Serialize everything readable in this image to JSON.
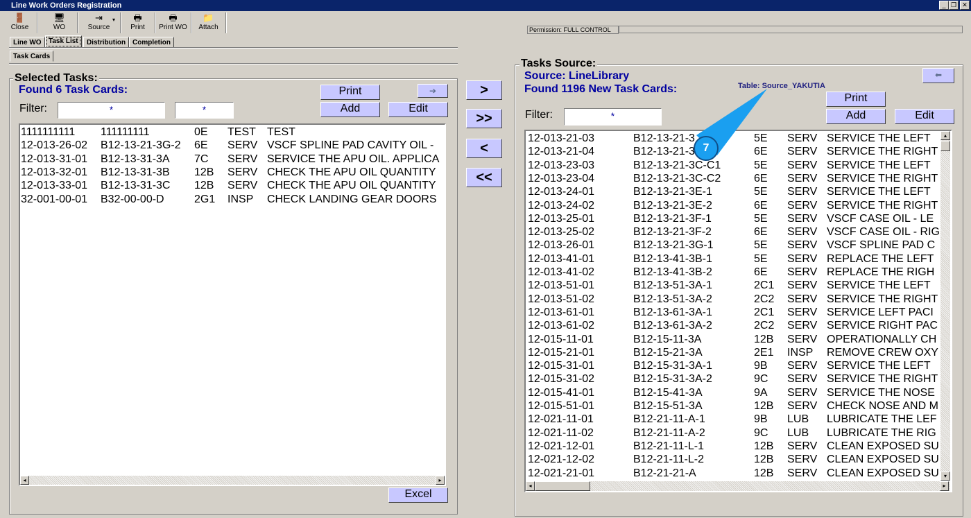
{
  "window": {
    "title": "Line Work Orders Registration"
  },
  "toolbar": [
    {
      "label": "Close",
      "icon": "door-exit-icon"
    },
    {
      "label": "WO",
      "icon": "wo-icon"
    },
    {
      "label": "Source",
      "icon": "source-icon"
    },
    {
      "label": "Print",
      "icon": "printer-icon"
    },
    {
      "label": "Print WO",
      "icon": "printer-icon"
    },
    {
      "label": "Attach",
      "icon": "attach-icon"
    }
  ],
  "permission": {
    "label": "Permission:",
    "value": "FULL CONTROL"
  },
  "tabs": [
    "Line WO",
    "Task List",
    "Distribution",
    "Completion"
  ],
  "subtabs": [
    "Task Cards"
  ],
  "selected": {
    "title": "Selected Tasks:",
    "found": "Found 6 Task Cards:",
    "filter_label": "Filter:",
    "filter1": "*",
    "filter2": "*",
    "print": "Print",
    "add": "Add",
    "edit": "Edit",
    "excel": "Excel",
    "rows": [
      [
        "1111111111",
        "111111111",
        "0E",
        "TEST",
        "TEST"
      ],
      [
        "12-013-26-02",
        "B12-13-21-3G-2",
        "6E",
        "SERV",
        "VSCF SPLINE PAD CAVITY OIL -"
      ],
      [
        "12-013-31-01",
        "B12-13-31-3A",
        "7C",
        "SERV",
        "SERVICE THE APU OIL. APPLICA"
      ],
      [
        "12-013-32-01",
        "B12-13-31-3B",
        "12B",
        "SERV",
        "CHECK THE APU OIL QUANTITY"
      ],
      [
        "12-013-33-01",
        "B12-13-31-3C",
        "12B",
        "SERV",
        "CHECK THE APU OIL QUANTITY"
      ],
      [
        "32-001-00-01",
        "B32-00-00-D",
        "2G1",
        "INSP",
        "CHECK LANDING GEAR DOORS"
      ]
    ]
  },
  "move": {
    "add_one": ">",
    "add_all": ">>",
    "remove_one": "<",
    "remove_all": "<<"
  },
  "source": {
    "title": "Tasks Source:",
    "source": "Source: LineLibrary",
    "found": "Found 1196 New Task Cards:",
    "table": "Table: Source_YAKUTIA",
    "filter_label": "Filter:",
    "filter": "*",
    "print": "Print",
    "add": "Add",
    "edit": "Edit",
    "rows": [
      [
        "12-013-21-03",
        "B12-13-21-3",
        "5E",
        "SERV",
        "SERVICE THE LEFT"
      ],
      [
        "12-013-21-04",
        "B12-13-21-3",
        "6E",
        "SERV",
        "SERVICE THE RIGHT"
      ],
      [
        "12-013-23-03",
        "B12-13-21-3C-C1",
        "5E",
        "SERV",
        "SERVICE THE LEFT"
      ],
      [
        "12-013-23-04",
        "B12-13-21-3C-C2",
        "6E",
        "SERV",
        "SERVICE THE RIGHT"
      ],
      [
        "12-013-24-01",
        "B12-13-21-3E-1",
        "5E",
        "SERV",
        "SERVICE THE LEFT"
      ],
      [
        "12-013-24-02",
        "B12-13-21-3E-2",
        "6E",
        "SERV",
        "SERVICE THE RIGHT"
      ],
      [
        "12-013-25-01",
        "B12-13-21-3F-1",
        "5E",
        "SERV",
        "VSCF CASE OIL - LE"
      ],
      [
        "12-013-25-02",
        "B12-13-21-3F-2",
        "6E",
        "SERV",
        "VSCF CASE OIL - RIG"
      ],
      [
        "12-013-26-01",
        "B12-13-21-3G-1",
        "5E",
        "SERV",
        "VSCF SPLINE PAD C"
      ],
      [
        "12-013-41-01",
        "B12-13-41-3B-1",
        "5E",
        "SERV",
        "REPLACE THE LEFT"
      ],
      [
        "12-013-41-02",
        "B12-13-41-3B-2",
        "6E",
        "SERV",
        "REPLACE THE RIGH"
      ],
      [
        "12-013-51-01",
        "B12-13-51-3A-1",
        "2C1",
        "SERV",
        "SERVICE THE LEFT"
      ],
      [
        "12-013-51-02",
        "B12-13-51-3A-2",
        "2C2",
        "SERV",
        "SERVICE THE RIGHT"
      ],
      [
        "12-013-61-01",
        "B12-13-61-3A-1",
        "2C1",
        "SERV",
        "SERVICE LEFT PACI"
      ],
      [
        "12-013-61-02",
        "B12-13-61-3A-2",
        "2C2",
        "SERV",
        "SERVICE RIGHT PAC"
      ],
      [
        "12-015-11-01",
        "B12-15-11-3A",
        "12B",
        "SERV",
        "OPERATIONALLY CH"
      ],
      [
        "12-015-21-01",
        "B12-15-21-3A",
        "2E1",
        "INSP",
        "REMOVE CREW OXY"
      ],
      [
        "12-015-31-01",
        "B12-15-31-3A-1",
        "9B",
        "SERV",
        "SERVICE THE LEFT"
      ],
      [
        "12-015-31-02",
        "B12-15-31-3A-2",
        "9C",
        "SERV",
        "SERVICE THE RIGHT"
      ],
      [
        "12-015-41-01",
        "B12-15-41-3A",
        "9A",
        "SERV",
        "SERVICE THE NOSE"
      ],
      [
        "12-015-51-01",
        "B12-15-51-3A",
        "12B",
        "SERV",
        "CHECK NOSE AND M"
      ],
      [
        "12-021-11-01",
        "B12-21-11-A-1",
        "9B",
        "LUB",
        "LUBRICATE THE LEF"
      ],
      [
        "12-021-11-02",
        "B12-21-11-A-2",
        "9C",
        "LUB",
        "LUBRICATE THE RIG"
      ],
      [
        "12-021-12-01",
        "B12-21-11-L-1",
        "12B",
        "SERV",
        "CLEAN EXPOSED SU"
      ],
      [
        "12-021-12-02",
        "B12-21-11-L-2",
        "12B",
        "SERV",
        "CLEAN EXPOSED SU"
      ],
      [
        "12-021-21-01",
        "B12-21-21-A",
        "12B",
        "SERV",
        "CLEAN EXPOSED SU"
      ]
    ]
  },
  "callout": {
    "number": "7",
    "color": "#1a9ff0"
  }
}
